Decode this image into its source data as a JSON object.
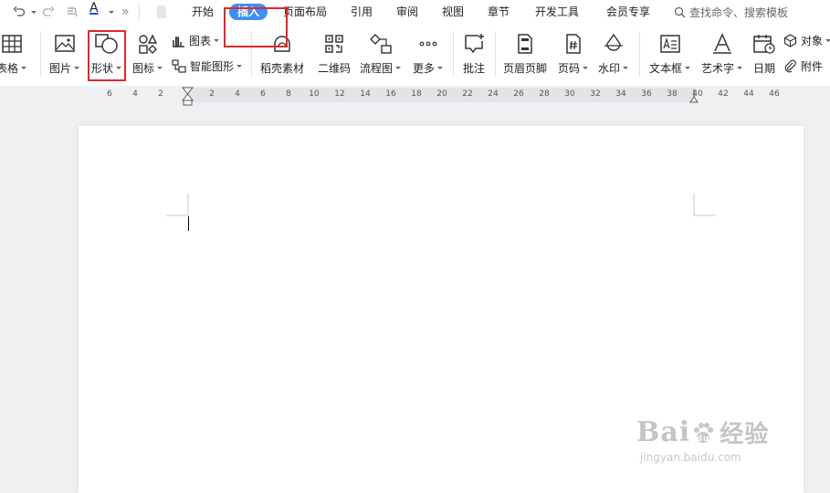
{
  "menubar": {
    "tabs": [
      {
        "label": "开始",
        "active": false
      },
      {
        "label": "插入",
        "active": true
      },
      {
        "label": "页面布局",
        "active": false
      },
      {
        "label": "引用",
        "active": false
      },
      {
        "label": "审阅",
        "active": false
      },
      {
        "label": "视图",
        "active": false
      },
      {
        "label": "章节",
        "active": false
      },
      {
        "label": "开发工具",
        "active": false
      },
      {
        "label": "会员专享",
        "active": false
      }
    ],
    "font_color_letter": "A",
    "more_symbol": "»",
    "search_placeholder": "查找命令、搜索模板"
  },
  "ribbon": {
    "table": "表格",
    "picture": "图片",
    "shape": "形状",
    "icon": "图标",
    "chart": "图表",
    "smart_graphic": "智能图形",
    "material": "稻壳素材",
    "qrcode": "二维码",
    "flowchart": "流程图",
    "more": "更多",
    "comment": "批注",
    "header_footer": "页眉页脚",
    "page_number": "页码",
    "watermark": "水印",
    "textbox": "文本框",
    "wordart": "艺术字",
    "date": "日期",
    "object": "对象",
    "attachment": "附件"
  },
  "ruler": {
    "ticks": [
      "6",
      "4",
      "2",
      "2",
      "4",
      "6",
      "8",
      "10",
      "12",
      "14",
      "16",
      "18",
      "20",
      "22",
      "24",
      "26",
      "28",
      "30",
      "32",
      "34",
      "36",
      "38",
      "40",
      "42",
      "44",
      "46"
    ]
  },
  "watermark": {
    "url": "jingyan.baidu.com"
  },
  "colors": {
    "accent": "#3f8ef7",
    "highlight": "#e2272a",
    "font_color_bar": "#1f4fd8"
  }
}
